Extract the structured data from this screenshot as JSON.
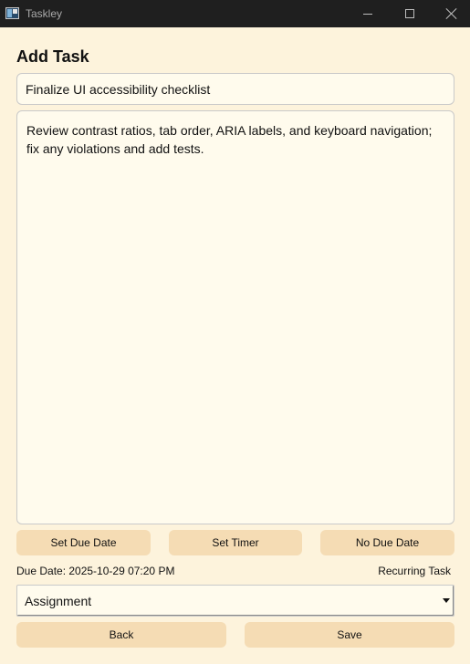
{
  "window": {
    "app_title": "Taskley"
  },
  "form": {
    "heading": "Add Task",
    "task_title_value": "Finalize UI accessibility checklist",
    "description_value": "Review contrast ratios, tab order, ARIA labels, and keyboard navigation; fix any violations and add tests.",
    "buttons": {
      "set_due_date": "Set Due Date",
      "set_timer": "Set Timer",
      "no_due_date": "No Due Date",
      "back": "Back",
      "save": "Save"
    },
    "due_date_text": "Due Date: 2025-10-29 07:20 PM",
    "recurring_text": "Recurring Task",
    "category_selected": "Assignment"
  },
  "colors": {
    "background": "#fdf3dc",
    "button": "#f5dcb4",
    "titlebar": "#1f1f1f"
  }
}
